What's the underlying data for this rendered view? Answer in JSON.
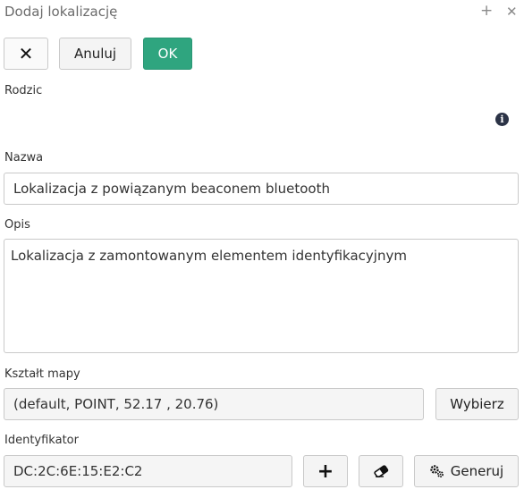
{
  "window": {
    "title": "Dodaj lokalizację",
    "plus_glyph": "+",
    "close_glyph": "✕"
  },
  "toolbar": {
    "close_glyph": "✕",
    "cancel_label": "Anuluj",
    "ok_label": "OK",
    "ok_color": "#2fa57f"
  },
  "form": {
    "parent_label": "Rodzic",
    "parent_info_icon": "info-icon",
    "name_label": "Nazwa",
    "name_value": "Lokalizacja z powiązanym beaconem bluetooth",
    "description_label": "Opis",
    "description_value": "Lokalizacja z zamontowanym elementem identyfikacyjnym",
    "map_shape_label": "Kształt mapy",
    "map_shape_value": "(default, POINT, 52.17 , 20.76)",
    "choose_label": "Wybierz",
    "identifier_label": "Identyfikator",
    "identifier_value": "DC:2C:6E:15:E2:C2",
    "add_glyph": "+",
    "clear_icon": "eraser-icon",
    "generate_label": "Generuj",
    "generate_icon": "gears-icon"
  }
}
